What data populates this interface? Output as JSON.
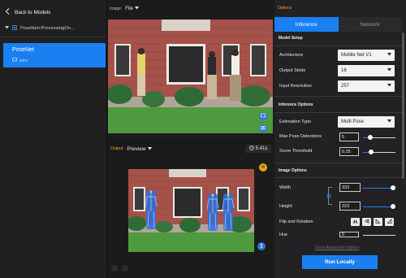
{
  "sidebar": {
    "back_label": "Back to Models",
    "project_label": "PoseNet+ProcessingOn...",
    "model": {
      "name": "PoseNet",
      "device": "GPU"
    }
  },
  "image_panel": {
    "tag": "Image:",
    "file_label": "File"
  },
  "output_panel": {
    "tag": "Output:",
    "view_label": "Preview",
    "elapsed": "5.41s"
  },
  "options": {
    "header": "Options",
    "tabs": [
      {
        "label": "Inference",
        "active": true
      },
      {
        "label": "Network",
        "active": false
      }
    ],
    "model_setup": {
      "title": "Model Setup",
      "architecture": {
        "label": "Architecture",
        "value": "Mobile Net V1"
      },
      "output_stride": {
        "label": "Output Stride",
        "value": "16"
      },
      "input_resolution": {
        "label": "Input Resolution",
        "value": "257"
      }
    },
    "inference_options": {
      "title": "Inference Options",
      "estimation_type": {
        "label": "Estimation Type",
        "value": "Multi Pose"
      },
      "max_detections": {
        "label": "Max Pose Detections",
        "value": "5"
      },
      "score_threshold": {
        "label": "Score Threshold",
        "value": "0.25"
      }
    },
    "image_options": {
      "title": "Image Options",
      "width": {
        "label": "Width",
        "value": "333"
      },
      "height": {
        "label": "Height",
        "value": "223"
      },
      "flip_rotation": {
        "label": "Flip and Rotation"
      },
      "hue": {
        "label": "Hue",
        "value": "0"
      }
    },
    "show_advanced": "Show Advanced Options",
    "run_label": "Run Locally"
  },
  "colors": {
    "accent": "#1a80f2",
    "output_tag": "#ff9f1a"
  }
}
